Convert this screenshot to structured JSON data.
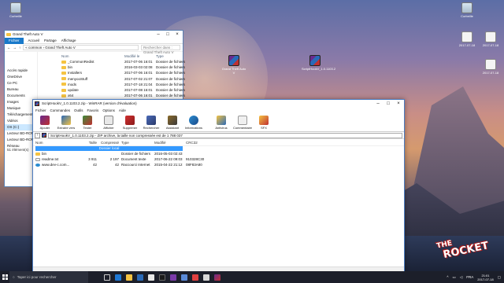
{
  "explorer": {
    "title": "Grand Theft Auto V",
    "ribbon_tabs": [
      "Fichier",
      "Accueil",
      "Partage",
      "Affichage"
    ],
    "path": "« common › Grand Theft Auto V",
    "search_placeholder": "Rechercher dans : Grand Theft Auto V",
    "nav": [
      "Accès rapide",
      "OneDrive",
      "Ce PC",
      "Bureau",
      "Documents",
      "Images",
      "Musique",
      "Téléchargements",
      "Vidéos",
      "OS (C:)",
      "Lecteur BD-ROM",
      "Lecteur BD-ROM (E:)",
      "Réseau"
    ],
    "columns": {
      "name": "Nom",
      "date": "Modifié le",
      "type": "Type"
    },
    "items": [
      {
        "name": "_CommonRedist",
        "date": "2017-07-06 16:01",
        "type": "Dossier de fichiers"
      },
      {
        "name": "bin",
        "date": "2016-03-03 02:08",
        "type": "Dossier de fichiers"
      },
      {
        "name": "Installers",
        "date": "2017-07-06 16:01",
        "type": "Dossier de fichiers"
      },
      {
        "name": "menyooStuff",
        "date": "2017-07-02 21:07",
        "type": "Dossier de fichiers"
      },
      {
        "name": "mods",
        "date": "2017-07-18 21:04",
        "type": "Dossier de fichiers"
      },
      {
        "name": "update",
        "date": "2017-07-08 16:01",
        "type": "Dossier de fichiers"
      },
      {
        "name": "x64",
        "date": "2017-07-06 16:01",
        "type": "Dossier de fichiers"
      }
    ],
    "status": "51 élément(s)"
  },
  "winrar": {
    "title": "ScriptHookV_1.0.1103.2.zip - WinRAR (version d'évaluation)",
    "menu": [
      "Fichier",
      "Commandes",
      "Outils",
      "Favoris",
      "Options",
      "Aide"
    ],
    "toolbar": [
      "Ajouter",
      "Extraire vers",
      "Tester",
      "Afficher",
      "Supprimer",
      "Rechercher",
      "Assistant",
      "Informations",
      "Antivirus",
      "Commentaire",
      "SFX"
    ],
    "path": "ScriptHookV_1.0.1103.2.zip - ZIP archive, la taille non compressée est de 1 788 037",
    "columns": {
      "name": "Nom",
      "size": "Taille",
      "packed": "Compressé",
      "type": "Type",
      "modified": "Modifié",
      "crc": "CRC32"
    },
    "dir_row": "Dossier local",
    "rows": [
      {
        "name": "bin",
        "size": "",
        "packed": "",
        "type": "Dossier de fichiers",
        "modified": "2016-05-03 02:43",
        "crc": ""
      },
      {
        "name": "readme.txt",
        "size": "3 911",
        "packed": "2 197",
        "type": "Document texte",
        "modified": "2017-06-22 09:03",
        "crc": "910328C30"
      },
      {
        "name": "www.dev-c.com...",
        "size": "42",
        "packed": "42",
        "type": "Raccourci Internet",
        "modified": "2015-04-22 21:12",
        "crc": "08F83A80"
      }
    ]
  },
  "desktop": {
    "icons_left": [
      "Corbeille"
    ],
    "icons_mid": [
      "Grand Theft Auto V",
      "ScriptHookV_1.0.1103.2"
    ],
    "icons_right": [
      "Corbeille",
      "2017-07-18",
      "2017-07-18",
      "2017-07-18"
    ]
  },
  "taskbar": {
    "search_placeholder": "Taper ici pour rechercher",
    "lang": "FRA",
    "time": "21:01",
    "date": "2017-07-18"
  },
  "brand": {
    "line1": "THE",
    "line2": "ROCKET"
  }
}
